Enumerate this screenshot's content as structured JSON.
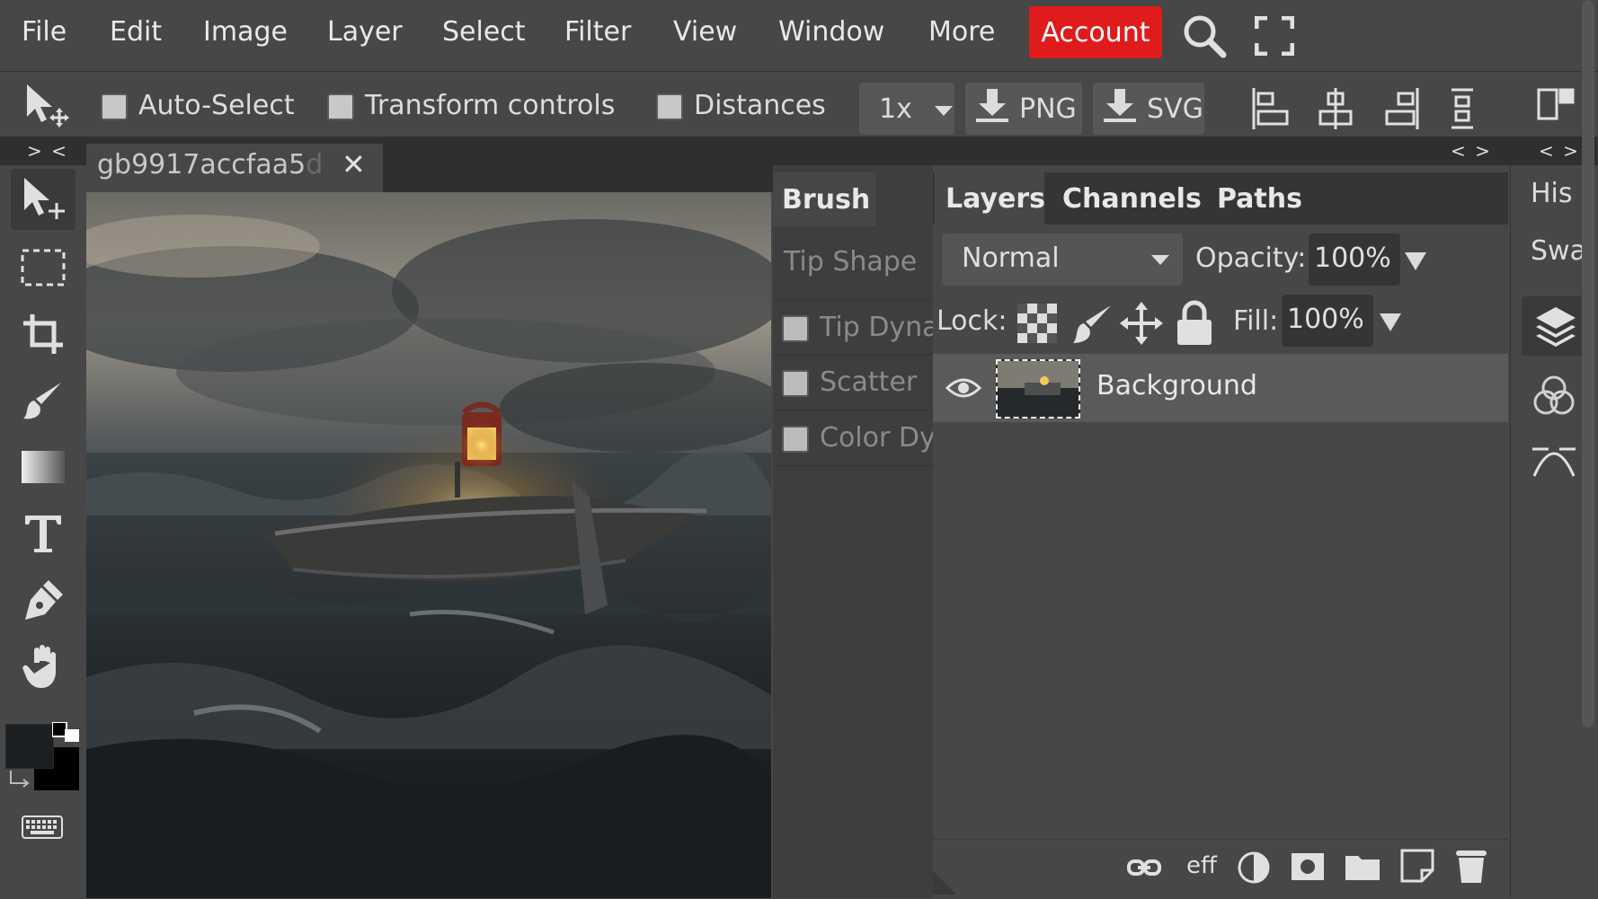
{
  "menubar": {
    "items": [
      "File",
      "Edit",
      "Image",
      "Layer",
      "Select",
      "Filter",
      "View",
      "Window",
      "More"
    ],
    "account": "Account",
    "account_color": "#e01b1b"
  },
  "options": {
    "auto_select": "Auto-Select",
    "transform_controls": "Transform controls",
    "distances": "Distances",
    "scale": "1x",
    "png": "PNG",
    "svg": "SVG"
  },
  "collapse": {
    "left": "> <",
    "mid": "< >",
    "right": "< >"
  },
  "document": {
    "tab_name": "gb9917accfaa5",
    "tab_name_faded": "d",
    "close": "✕"
  },
  "brush_panel": {
    "tab": "Brush",
    "tip_shape": "Tip Shape",
    "tip_dynamics": "Tip Dyna",
    "scatter": "Scatter",
    "color_dynamics": "Color Dy"
  },
  "layers_panel": {
    "tabs": [
      "Layers",
      "Channels",
      "Paths"
    ],
    "blend_mode": "Normal",
    "opacity_label": "Opacity:",
    "opacity_value": "100%",
    "lock_label": "Lock:",
    "fill_label": "Fill:",
    "fill_value": "100%",
    "layers": [
      {
        "name": "Background",
        "visible": true
      }
    ],
    "footer_eff": "eff"
  },
  "right_strip": {
    "history": "His",
    "swatches": "Swa"
  },
  "colors": {
    "foreground": "#1c1f22",
    "background": "#000000"
  }
}
